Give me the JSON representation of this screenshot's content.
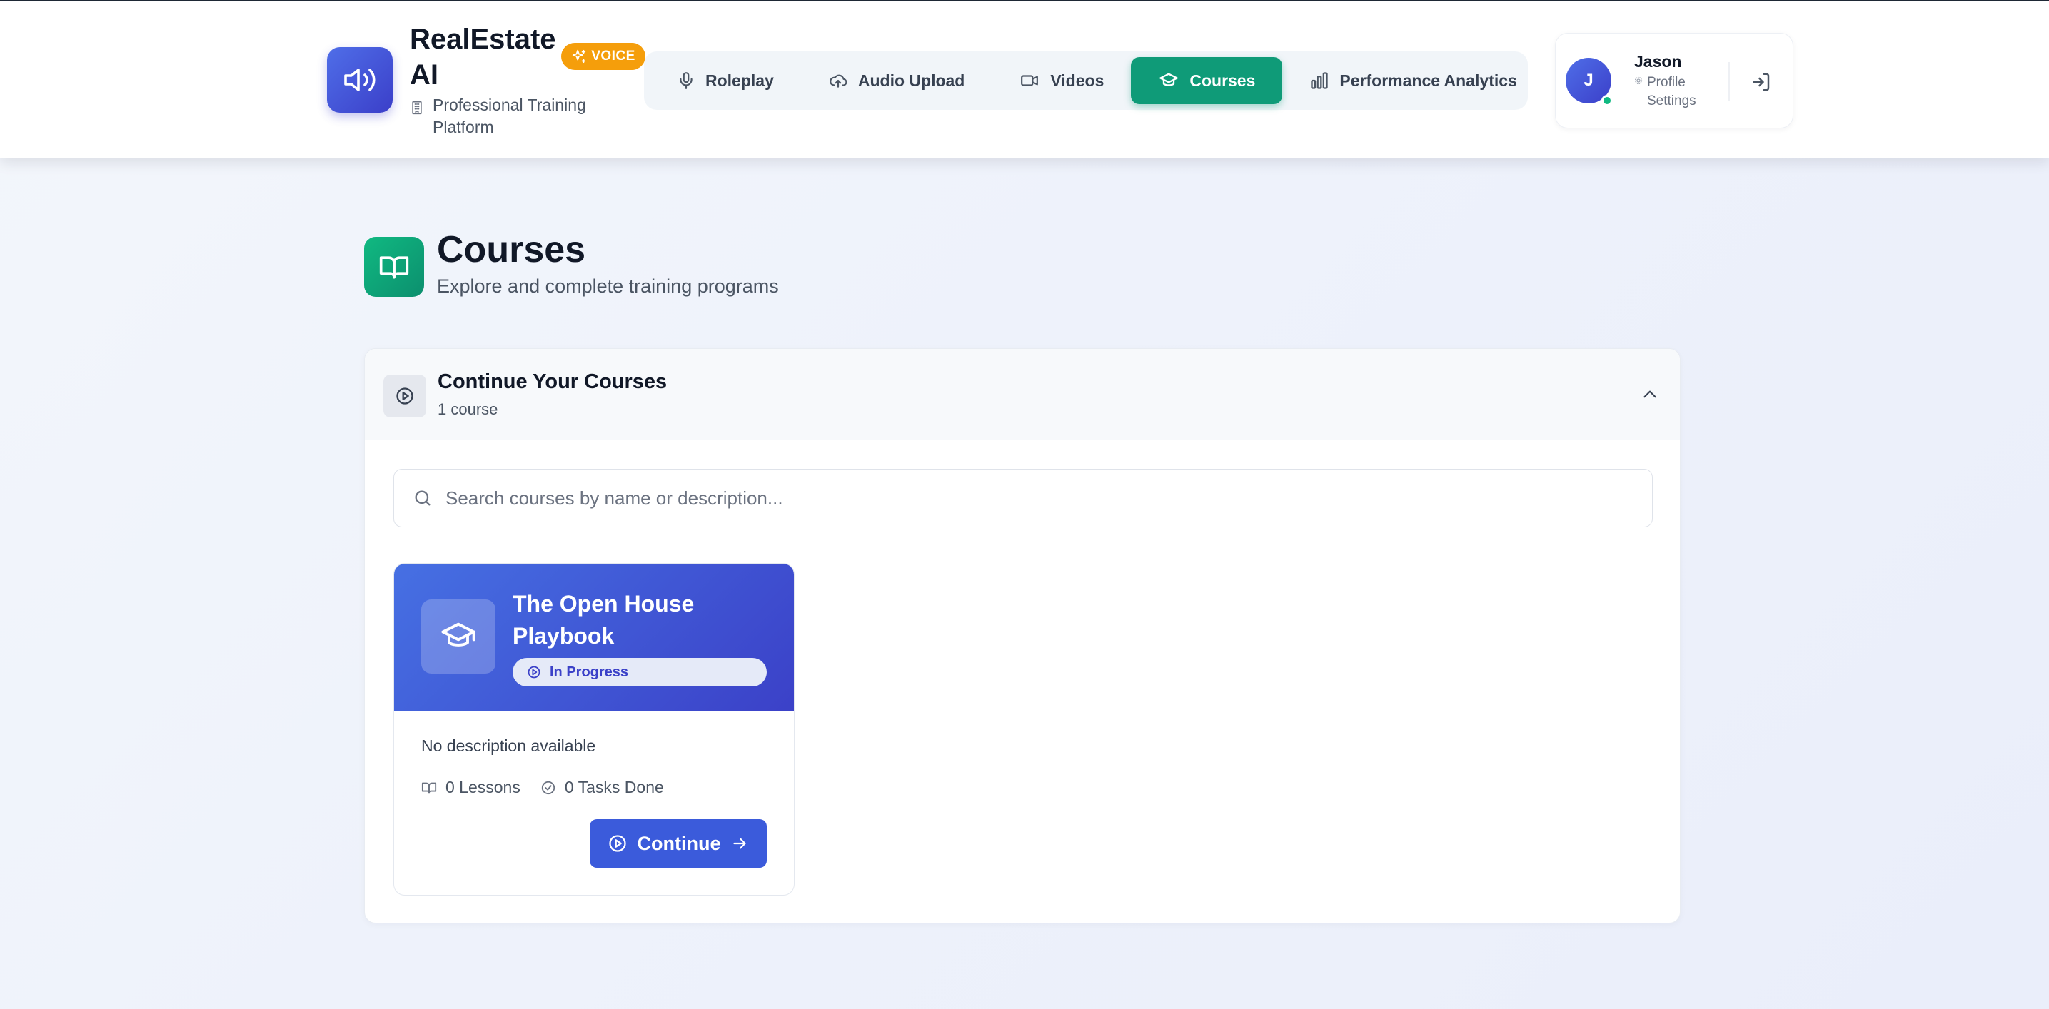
{
  "app": {
    "brand_title": "RealEstate AI",
    "badge": "VOICE",
    "subtitle": "Professional Training Platform"
  },
  "nav": {
    "items": [
      {
        "label": "Roleplay",
        "icon": "microphone-icon",
        "active": false
      },
      {
        "label": "Audio Upload",
        "icon": "cloud-upload-icon",
        "active": false
      },
      {
        "label": "Videos",
        "icon": "video-camera-icon",
        "active": false
      },
      {
        "label": "Courses",
        "icon": "graduation-cap-icon",
        "active": true
      },
      {
        "label": "Performance Analytics",
        "icon": "bar-chart-icon",
        "active": false
      }
    ]
  },
  "user": {
    "initial": "J",
    "name": "Jason",
    "settings_label": "Profile Settings",
    "online": true
  },
  "page": {
    "title": "Courses",
    "subtitle": "Explore and complete training programs"
  },
  "section": {
    "title": "Continue Your Courses",
    "count": "1 course"
  },
  "search": {
    "placeholder": "Search courses by name or description...",
    "value": ""
  },
  "courses": [
    {
      "title": "The Open House Playbook",
      "status": "In Progress",
      "description": "No description available",
      "lessons": "0 Lessons",
      "tasks": "0 Tasks Done",
      "button": "Continue"
    }
  ],
  "colors": {
    "brand": "#3b41c8",
    "active_nav": "#0f9b78",
    "voice_badge": "#f59e0b",
    "online": "#10b981"
  }
}
